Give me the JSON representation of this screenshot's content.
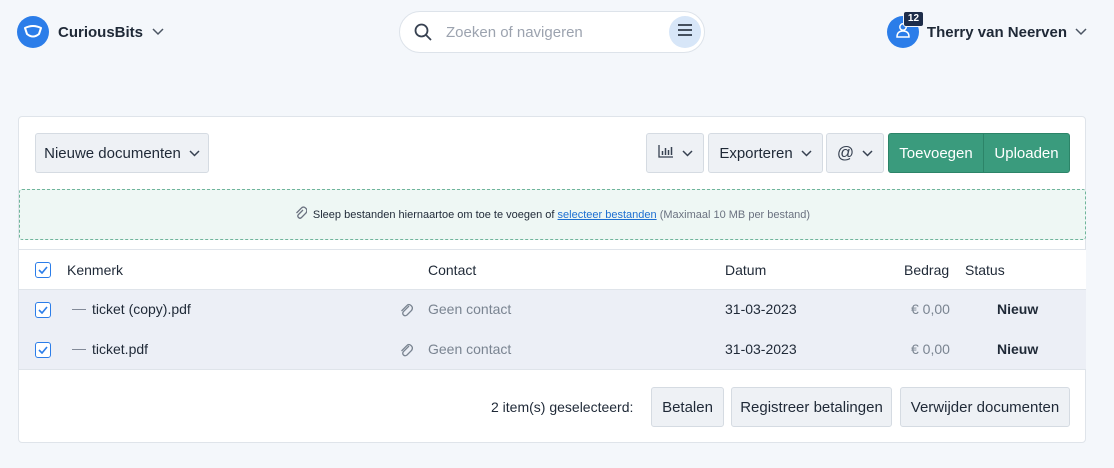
{
  "header": {
    "brand_name": "CuriousBits",
    "search_placeholder": "Zoeken of navigeren",
    "user_name": "Therry van Neerven",
    "notification_count": "12"
  },
  "toolbar": {
    "view_select": "Nieuwe documenten",
    "export_label": "Exporteren",
    "add_label": "Toevoegen",
    "upload_label": "Uploaden"
  },
  "dropzone": {
    "text": "Sleep bestanden hiernaartoe om toe te voegen of",
    "link": "selecteer bestanden",
    "hint": "(Maximaal 10 MB per bestand)"
  },
  "table": {
    "headers": {
      "reference": "Kenmerk",
      "contact": "Contact",
      "date": "Datum",
      "amount": "Bedrag",
      "status": "Status"
    },
    "rows": [
      {
        "reference": "ticket (copy).pdf",
        "contact": "Geen contact",
        "date": "31-03-2023",
        "amount": "€ 0,00",
        "status": "Nieuw",
        "checked": true
      },
      {
        "reference": "ticket.pdf",
        "contact": "Geen contact",
        "date": "31-03-2023",
        "amount": "€ 0,00",
        "status": "Nieuw",
        "checked": true
      }
    ]
  },
  "footer": {
    "selected_text": "2 item(s) geselecteerd:",
    "pay_label": "Betalen",
    "register_label": "Registreer betalingen",
    "delete_label": "Verwijder documenten"
  },
  "colors": {
    "primary": "#2b7de9",
    "green": "#3a9b7d",
    "badge": "#1e2d4a"
  },
  "icons": [
    "brand-logo-icon",
    "chevron-down-icon",
    "search-icon",
    "menu-icon",
    "user-icon",
    "bar-chart-icon",
    "at-icon",
    "paperclip-icon",
    "checkbox-icon",
    "dash-icon"
  ]
}
